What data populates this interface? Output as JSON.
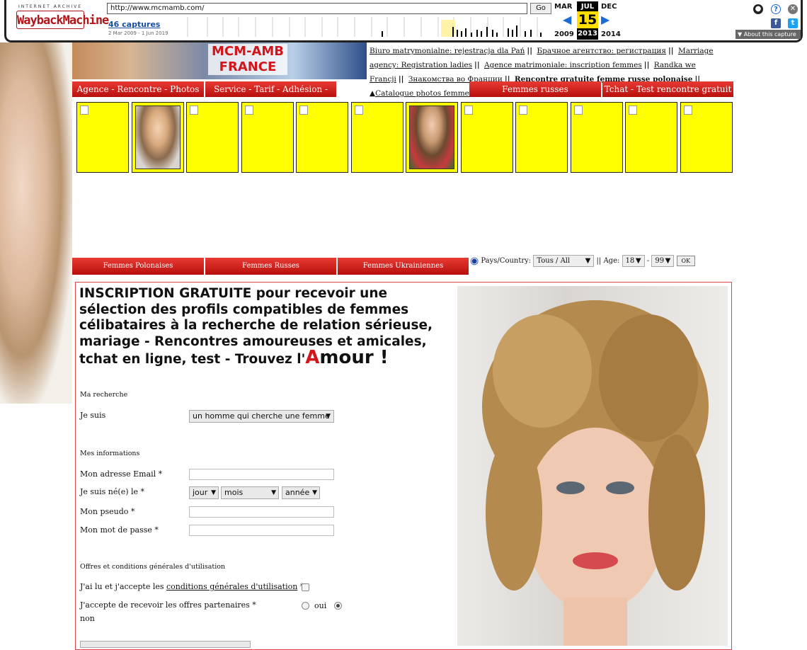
{
  "wayback": {
    "logo_top": "INTERNET ARCHIVE",
    "logo_main": "WaybackMachine",
    "url": "http://www.mcmamb.com/",
    "go": "Go",
    "captures": "46 captures",
    "range": "2 Mar 2009 - 1 Jun 2019",
    "prev_month": "MAR",
    "cur_month": "JUL",
    "next_month": "DEC",
    "day": "15",
    "prev_year": "2009",
    "cur_year": "2013",
    "next_year": "2014",
    "about": "▼ About this capture"
  },
  "site": {
    "brand_line1": "MCM-AMB",
    "brand_line2": "FRANCE",
    "links": [
      "Biuro matrymonialne: rejestracja dla Pań",
      "Брачное агентство: регистрация",
      "Marriage agency: Registration ladies",
      "Agence matrimoniale: inscription femmes",
      "Randka we Francji",
      "Знакомства во Франции",
      "Rencontre gratuite femme russe polonaise",
      "Catalogue photos femmes"
    ],
    "nav": [
      "Agence - Rencontre - Photos",
      "Service - Tarif - Adhésion - Video",
      "Femmes russes",
      "Tchat - Test rencontre gratuit"
    ],
    "subnav": [
      "Femmes Polonaises",
      "Femmes Russes",
      "Femmes Ukrainiennes"
    ],
    "filter": {
      "label_country": "Pays/Country:",
      "country": "Tous / All",
      "label_age": "|| Age:",
      "age_min": "18",
      "dash": "-",
      "age_max": "99",
      "ok": "OK"
    }
  },
  "form": {
    "title_main": "INSCRIPTION GRATUITE pour recevoir une sélection des profils compatibles de femmes célibataires à la recherche de relation sérieuse, mariage - Rencontres amoureuses et amicales, tchat en ligne, test - Trouvez l'",
    "title_big": "A",
    "title_end": "mour !",
    "sec_recherche": "Ma recherche",
    "je_suis": "Je suis",
    "je_suis_value": "un homme qui cherche une femme",
    "sec_infos": "Mes informations",
    "email_label": "Mon adresse Email *",
    "dob_label": "Je suis né(e) le *",
    "dob_day": "jour",
    "dob_month": "mois",
    "dob_year": "année",
    "pseudo_label": "Mon pseudo *",
    "password_label": "Mon mot de passe *",
    "sec_offres": "Offres et conditions générales d'utilisation",
    "cgu_pre": "J'ai lu et j'accepte les ",
    "cgu_link": "conditions générales d'utilisation",
    "cgu_post": " *",
    "offres_label": "J'accepte de recevoir les offres partenaires *",
    "oui": "oui",
    "non": "non"
  },
  "colors": {
    "accent_red": "#d3161a",
    "thumb_yellow": "#ffff00",
    "wayback_blue": "#1a6bd6"
  }
}
